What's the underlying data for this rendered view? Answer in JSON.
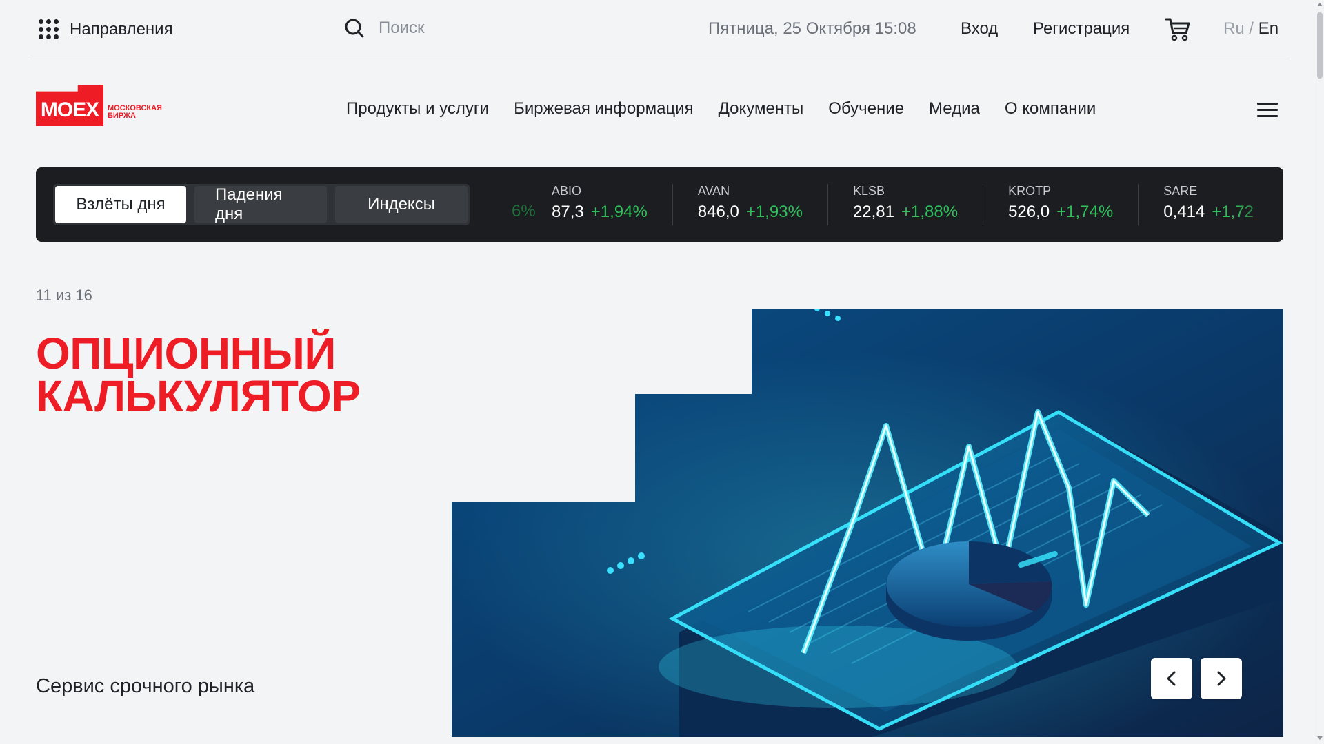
{
  "topbar": {
    "directions_label": "Направления",
    "search_placeholder": "Поиск",
    "datetime": "Пятница, 25 Октября 15:08",
    "login": "Вход",
    "register": "Регистрация",
    "lang_ru": "Ru",
    "lang_sep": " / ",
    "lang_en": "En"
  },
  "logo": {
    "text": "MOEX",
    "subtitle_line1": "Московская",
    "subtitle_line2": "биржа",
    "brand_color": "#ee1c25"
  },
  "nav": {
    "items": [
      "Продукты и услуги",
      "Биржевая информация",
      "Документы",
      "Обучение",
      "Медиа",
      "О компании"
    ]
  },
  "ticker": {
    "tabs": [
      "Взлёты дня",
      "Падения дня",
      "Индексы"
    ],
    "active_tab": "Взлёты дня",
    "partial_prev": "6%",
    "quotes": [
      {
        "symbol": "ABIO",
        "price": "87,3",
        "change": "+1,94%"
      },
      {
        "symbol": "AVAN",
        "price": "846,0",
        "change": "+1,93%"
      },
      {
        "symbol": "KLSB",
        "price": "22,81",
        "change": "+1,88%"
      },
      {
        "symbol": "KROTP",
        "price": "526,0",
        "change": "+1,74%"
      },
      {
        "symbol": "SARE",
        "price": "0,414",
        "change": "+1,72"
      }
    ],
    "up_color": "#2fbf5b"
  },
  "hero": {
    "counter": "11 из 16",
    "title_line1": "ОПЦИОННЫЙ",
    "title_line2": "КАЛЬКУЛЯТОР",
    "subtitle": "Сервис срочного рынка",
    "accent": "#ee1c25"
  }
}
